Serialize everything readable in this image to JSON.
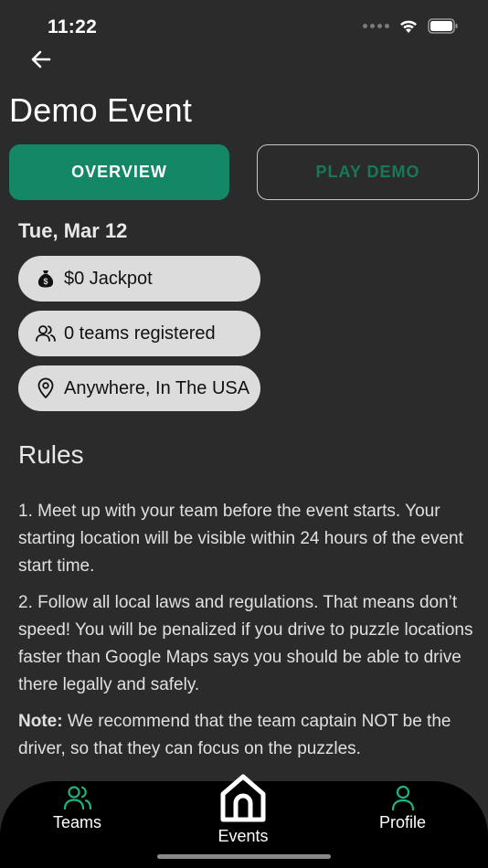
{
  "status_bar": {
    "time": "11:22"
  },
  "header": {
    "title": "Demo Event"
  },
  "tabs": [
    {
      "label": "OVERVIEW",
      "active": true
    },
    {
      "label": "PLAY DEMO",
      "active": false
    }
  ],
  "event": {
    "date": "Tue, Mar 12",
    "jackpot": "$0 Jackpot",
    "teams_registered": "0 teams registered",
    "location": "Anywhere, In The USA"
  },
  "rules": {
    "heading": "Rules",
    "rule_1": "1. Meet up with your team before the event starts. Your starting location will be visible within 24 hours of the event start time.",
    "rule_2": "2. Follow all local laws and regulations. That means don’t speed! You will be penalized if you drive to puzzle locations faster than Google Maps says you should be able to drive there legally and safely.",
    "note_label": "Note:",
    "note_text": " We recommend that the team captain NOT be the driver, so that they can focus on the puzzles."
  },
  "bottom_nav": {
    "teams": "Teams",
    "events": "Events",
    "profile": "Profile"
  },
  "colors": {
    "background": "#2b2b2b",
    "accent": "#148866",
    "pill": "#dcdcdc",
    "nav_icon": "#1db57f"
  },
  "icons": {
    "back": "arrow-left-icon",
    "jackpot": "money-bag-icon",
    "teams": "users-icon",
    "location": "map-pin-icon",
    "home": "home-icon",
    "profile": "user-icon"
  }
}
